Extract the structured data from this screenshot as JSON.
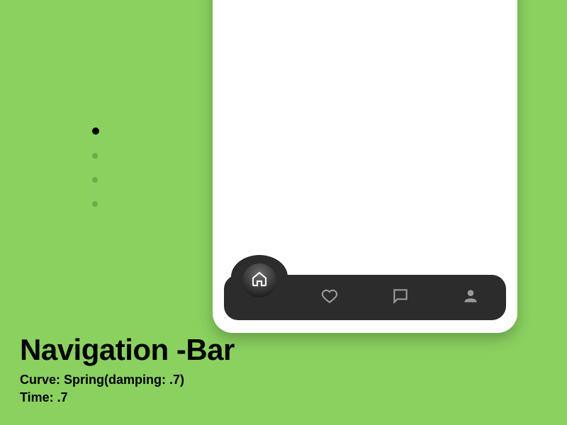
{
  "caption": {
    "title": "Navigation -Bar",
    "curve_line": "Curve: Spring(damping: .7)",
    "time_line": "Time: .7"
  },
  "page_indicator": {
    "count": 4,
    "active_index": 0
  },
  "nav": {
    "active_index": 0,
    "items": [
      {
        "name": "home",
        "icon": "home-icon"
      },
      {
        "name": "likes",
        "icon": "heart-icon"
      },
      {
        "name": "chat",
        "icon": "chat-icon"
      },
      {
        "name": "profile",
        "icon": "person-icon"
      }
    ]
  },
  "animation": {
    "curve": "Spring",
    "damping": 0.7,
    "time": 0.7
  }
}
